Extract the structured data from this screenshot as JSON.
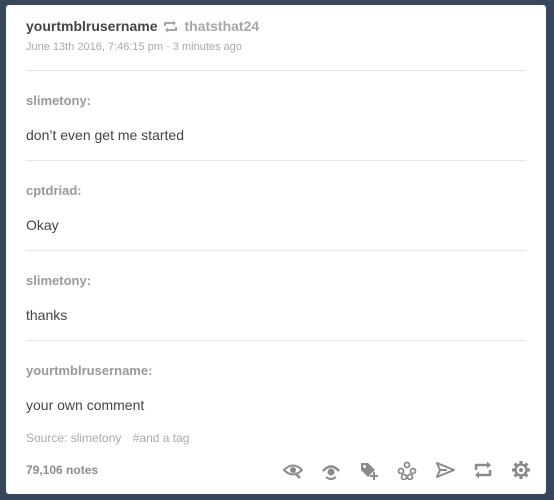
{
  "post": {
    "author": "yourtmblrusername",
    "reblog_icon": "reblog-icon",
    "reblogged_from": "thatsthat24",
    "date": "June 13th 2016, 7:46:15 pm",
    "separator": "·",
    "relative_time": "3 minutes ago"
  },
  "thread": [
    {
      "user": "slimetony:",
      "text": "don’t even get me started"
    },
    {
      "user": "cptdriad:",
      "text": "Okay"
    },
    {
      "user": "slimetony:",
      "text": "thanks"
    },
    {
      "user": "yourtmblrusername:",
      "text": "your own comment"
    }
  ],
  "source": {
    "label": "Source: slimetony",
    "tag": "#and a tag"
  },
  "footer": {
    "notes": "79,106 notes",
    "actions": [
      "eye-icon",
      "hide-icon",
      "add-tag-icon",
      "queue-icon",
      "share-icon",
      "reblog-icon",
      "settings-icon"
    ]
  },
  "colors": {
    "background": "#36465d",
    "card": "#ffffff",
    "icon": "#8a8a8a"
  }
}
